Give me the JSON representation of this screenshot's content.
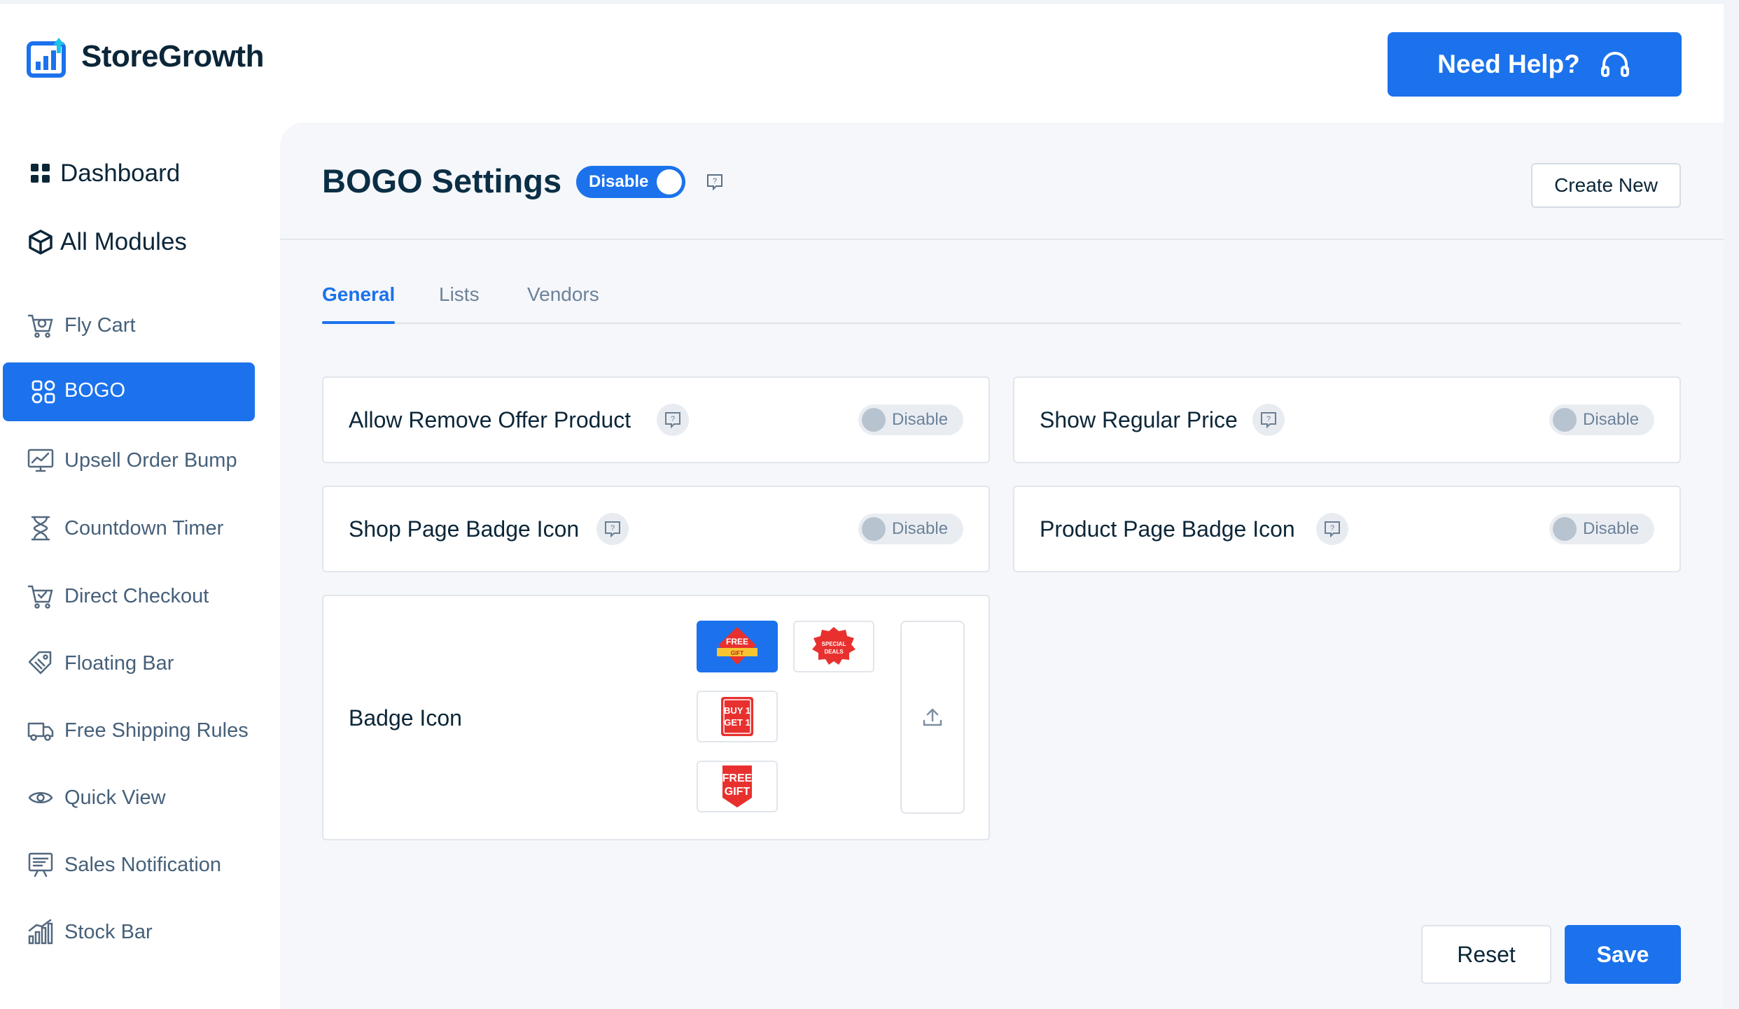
{
  "brand": {
    "name": "StoreGrowth",
    "accent": "#1b72ec"
  },
  "header": {
    "help_label": "Need Help?",
    "help_icon": "headset-icon"
  },
  "sidebar": {
    "top": [
      {
        "label": "Dashboard",
        "icon": "grid-icon"
      },
      {
        "label": "All Modules",
        "icon": "cube-icon"
      }
    ],
    "items": [
      {
        "label": "Fly Cart",
        "icon": "cart-icon"
      },
      {
        "label": "BOGO",
        "icon": "bogo-icon",
        "active": true
      },
      {
        "label": "Upsell Order Bump",
        "icon": "chart-screen-icon"
      },
      {
        "label": "Countdown Timer",
        "icon": "hourglass-icon"
      },
      {
        "label": "Direct Checkout",
        "icon": "cart-check-icon"
      },
      {
        "label": "Floating Bar",
        "icon": "tag-icon"
      },
      {
        "label": "Free Shipping Rules",
        "icon": "truck-icon"
      },
      {
        "label": "Quick View",
        "icon": "eye-icon"
      },
      {
        "label": "Sales Notification",
        "icon": "notification-icon"
      },
      {
        "label": "Stock Bar",
        "icon": "bars-icon"
      }
    ]
  },
  "page": {
    "title": "BOGO Settings",
    "module_toggle": {
      "label": "Disable",
      "state": "on"
    },
    "create_label": "Create New"
  },
  "tabs": [
    {
      "label": "General",
      "active": true
    },
    {
      "label": "Lists"
    },
    {
      "label": "Vendors"
    }
  ],
  "settings": [
    {
      "label": "Allow Remove Offer Product",
      "toggle": "Disable"
    },
    {
      "label": "Show Regular Price",
      "toggle": "Disable"
    },
    {
      "label": "Shop Page Badge Icon",
      "toggle": "Disable"
    },
    {
      "label": "Product Page Badge Icon",
      "toggle": "Disable"
    }
  ],
  "badge_icon": {
    "label": "Badge Icon",
    "options": [
      {
        "icon": "free-gift-ribbon-icon",
        "text_top": "FREE",
        "text_bottom": "GIFT",
        "selected": true
      },
      {
        "icon": "special-deals-seal-icon",
        "text_top": "SPECIAL",
        "text_bottom": "DEALS"
      },
      {
        "icon": "buy1-get1-stamp-icon",
        "text_top": "BUY 1",
        "text_bottom": "GET 1"
      },
      {
        "icon": "free-gift-tag-icon",
        "text_top": "FREE",
        "text_bottom": "GIFT"
      }
    ],
    "upload_icon": "upload-icon"
  },
  "footer": {
    "reset_label": "Reset",
    "save_label": "Save"
  }
}
